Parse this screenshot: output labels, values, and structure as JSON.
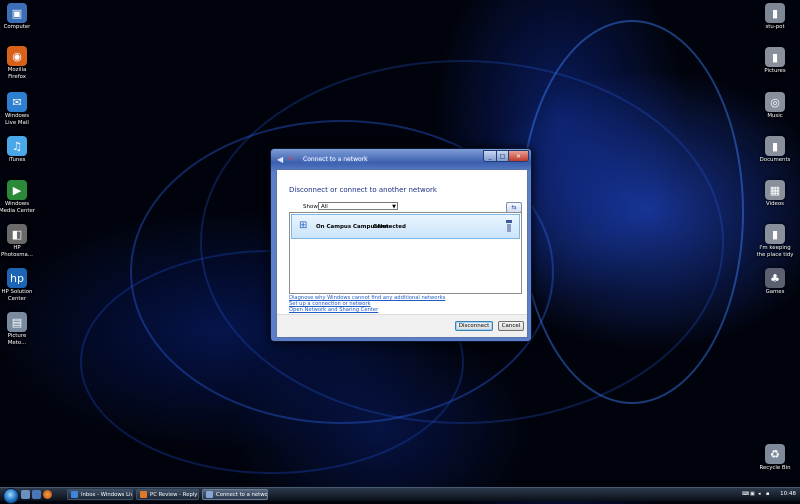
{
  "desktop": {
    "left_icons": [
      {
        "name": "computer",
        "label": [
          "Computer"
        ],
        "glyph": "▣",
        "color": "#3a6fb8"
      },
      {
        "name": "mozilla-firefox",
        "label": [
          "Mozilla",
          "Firefox"
        ],
        "glyph": "◉",
        "color": "#d8621a"
      },
      {
        "name": "windows-live-mail",
        "label": [
          "Windows",
          "Live Mail"
        ],
        "glyph": "✉",
        "color": "#2f7fd0"
      },
      {
        "name": "itunes",
        "label": [
          "iTunes"
        ],
        "glyph": "♫",
        "color": "#4aa8e8"
      },
      {
        "name": "windows-media-center",
        "label": [
          "Windows",
          "Media Center"
        ],
        "glyph": "▶",
        "color": "#2a8a3a"
      },
      {
        "name": "hp-photosmart",
        "label": [
          "HP",
          "Photosma..."
        ],
        "glyph": "◧",
        "color": "#6a6a6a"
      },
      {
        "name": "hp-solution-center",
        "label": [
          "HP Solution",
          "Center"
        ],
        "glyph": "hp",
        "color": "#1e64b4"
      },
      {
        "name": "picture-metro",
        "label": [
          "Picture",
          "Meto..."
        ],
        "glyph": "▤",
        "color": "#7a8aa0"
      }
    ],
    "right_icons": [
      {
        "name": "stu-pot",
        "label": [
          "stu-pot"
        ],
        "glyph": "▮",
        "color": "#7d8796"
      },
      {
        "name": "pictures",
        "label": [
          "Pictures"
        ],
        "glyph": "▮",
        "color": "#8a8f9c"
      },
      {
        "name": "music",
        "label": [
          "Music"
        ],
        "glyph": "◎",
        "color": "#8a8f9c"
      },
      {
        "name": "documents",
        "label": [
          "Documents"
        ],
        "glyph": "▮",
        "color": "#8a8f9c"
      },
      {
        "name": "videos",
        "label": [
          "Videos"
        ],
        "glyph": "▦",
        "color": "#8a8f9c"
      },
      {
        "name": "keeping-the-place-tidy",
        "label": [
          "I'm keeping",
          "the place tidy"
        ],
        "glyph": "▮",
        "color": "#8a8f9c"
      },
      {
        "name": "games",
        "label": [
          "Games"
        ],
        "glyph": "♣",
        "color": "#5a6070"
      },
      {
        "name": "recycle-bin",
        "label": [
          "Recycle Bin"
        ],
        "glyph": "♻",
        "color": "#7e8a9a"
      }
    ]
  },
  "dialog": {
    "title": "Connect to a network",
    "caption_buttons": {
      "minimize": "_",
      "maximize": "□",
      "close": "✕"
    },
    "heading": "Disconnect or connect to another network",
    "show_label": "Show",
    "show_value": "All",
    "refresh_glyph": "⇆",
    "network": {
      "name": "On Campus CampusNet",
      "status": "Connected"
    },
    "links": [
      "Diagnose why Windows cannot find any additional networks",
      "Set up a connection or network",
      "Open Network and Sharing Center"
    ],
    "buttons": {
      "disconnect": "Disconnect",
      "cancel": "Cancel"
    }
  },
  "taskbar": {
    "tasks": [
      {
        "label": "Inbox - Windows Liv...",
        "color": "#3f86d8",
        "active": false
      },
      {
        "label": "PC Review - Reply t...",
        "color": "#e07828",
        "active": false
      },
      {
        "label": "Connect to a network",
        "color": "#88a4d4",
        "active": true
      }
    ],
    "clock": "10:48"
  }
}
